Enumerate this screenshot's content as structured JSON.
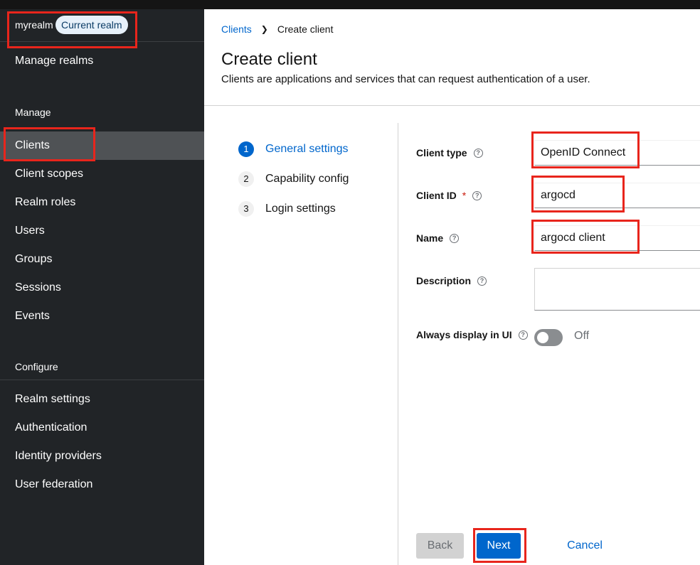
{
  "sidebar": {
    "realm_name": "myrealm",
    "realm_badge": "Current realm",
    "manage_realms": "Manage realms",
    "manage_section": "Manage",
    "manage_items": [
      {
        "label": "Clients",
        "active": true
      },
      {
        "label": "Client scopes"
      },
      {
        "label": "Realm roles"
      },
      {
        "label": "Users"
      },
      {
        "label": "Groups"
      },
      {
        "label": "Sessions"
      },
      {
        "label": "Events"
      }
    ],
    "configure_section": "Configure",
    "configure_items": [
      {
        "label": "Realm settings"
      },
      {
        "label": "Authentication"
      },
      {
        "label": "Identity providers"
      },
      {
        "label": "User federation"
      }
    ]
  },
  "breadcrumb": {
    "parent": "Clients",
    "current": "Create client"
  },
  "page": {
    "title": "Create client",
    "description": "Clients are applications and services that can request authentication of a user."
  },
  "wizard": {
    "steps": [
      {
        "num": "1",
        "label": "General settings",
        "current": true
      },
      {
        "num": "2",
        "label": "Capability config"
      },
      {
        "num": "3",
        "label": "Login settings"
      }
    ]
  },
  "form": {
    "client_type_label": "Client type",
    "client_type_value": "OpenID Connect",
    "client_id_label": "Client ID",
    "client_id_required": "*",
    "client_id_value": "argocd",
    "name_label": "Name",
    "name_value": "argocd client",
    "description_label": "Description",
    "description_value": "",
    "always_display_label": "Always display in UI",
    "always_display_state": "Off",
    "help_icon_glyph": "?"
  },
  "footer": {
    "back": "Back",
    "next": "Next",
    "cancel": "Cancel"
  },
  "colors": {
    "accent": "#0066cc",
    "sidebar_bg": "#212427",
    "annotation": "#e8251c"
  }
}
